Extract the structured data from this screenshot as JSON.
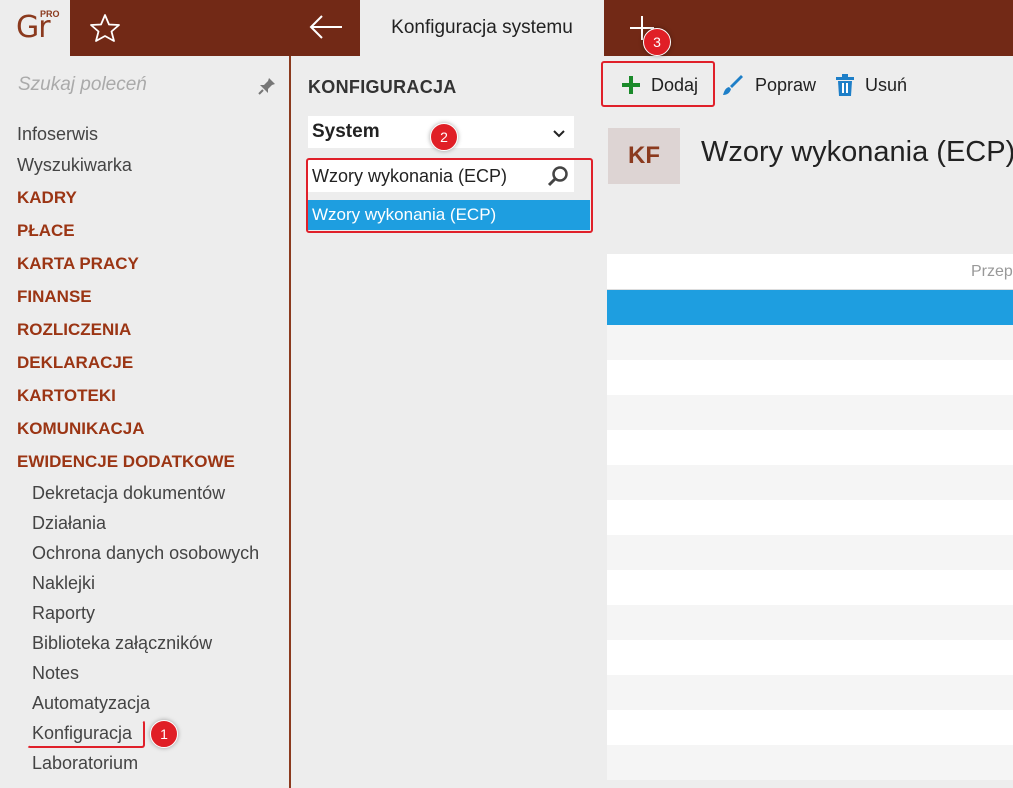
{
  "app": {
    "logo_text": "Gr",
    "logo_badge": "PRO",
    "tab_title": "Konfiguracja systemu"
  },
  "sidebar": {
    "search_placeholder": "Szukaj poleceń",
    "items": [
      {
        "label": "Infoserwis",
        "kind": "plain"
      },
      {
        "label": "Wyszukiwarka",
        "kind": "plain"
      },
      {
        "label": "KADRY",
        "kind": "cat"
      },
      {
        "label": "PŁACE",
        "kind": "cat"
      },
      {
        "label": "KARTA PRACY",
        "kind": "cat"
      },
      {
        "label": "FINANSE",
        "kind": "cat"
      },
      {
        "label": "ROZLICZENIA",
        "kind": "cat"
      },
      {
        "label": "DEKLARACJE",
        "kind": "cat"
      },
      {
        "label": "KARTOTEKI",
        "kind": "cat"
      },
      {
        "label": "KOMUNIKACJA",
        "kind": "cat"
      },
      {
        "label": "EWIDENCJE DODATKOWE",
        "kind": "cat"
      },
      {
        "label": "Dekretacja dokumentów",
        "kind": "sub"
      },
      {
        "label": "Działania",
        "kind": "sub"
      },
      {
        "label": "Ochrona danych osobowych",
        "kind": "sub"
      },
      {
        "label": "Naklejki",
        "kind": "sub"
      },
      {
        "label": "Raporty",
        "kind": "sub"
      },
      {
        "label": "Biblioteka załączników",
        "kind": "sub"
      },
      {
        "label": "Notes",
        "kind": "sub"
      },
      {
        "label": "Automatyzacja",
        "kind": "sub"
      },
      {
        "label": "Konfiguracja",
        "kind": "sub"
      },
      {
        "label": "Laboratorium",
        "kind": "sub"
      }
    ]
  },
  "config_panel": {
    "heading": "KONFIGURACJA",
    "select_value": "System",
    "filter_value": "Wzory wykonania (ECP)",
    "result_item": "Wzory wykonania (ECP)"
  },
  "toolbar": {
    "add_label": "Dodaj",
    "edit_label": "Popraw",
    "delete_label": "Usuń"
  },
  "content": {
    "badge": "KF",
    "title": "Wzory wykonania (ECP)",
    "grid_header": "Przep"
  },
  "annotations": {
    "step1": "1",
    "step2": "2",
    "step3": "3"
  },
  "colors": {
    "brand": "#722916",
    "category": "#9b3514",
    "selection": "#1e9ee0",
    "annotation": "#e01f26"
  }
}
